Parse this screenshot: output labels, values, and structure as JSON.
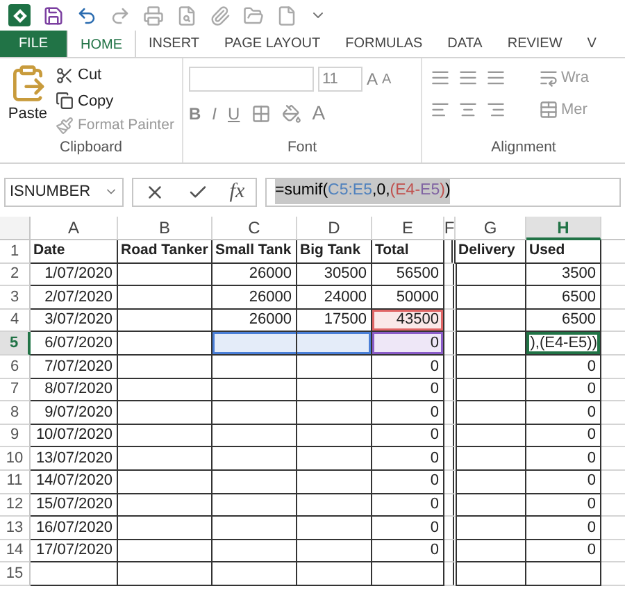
{
  "tabs": [
    {
      "label": "FILE",
      "kind": "file",
      "selected": false
    },
    {
      "label": "HOME",
      "kind": "tab",
      "selected": true
    },
    {
      "label": "INSERT",
      "kind": "tab",
      "selected": false
    },
    {
      "label": "PAGE LAYOUT",
      "kind": "tab",
      "selected": false
    },
    {
      "label": "FORMULAS",
      "kind": "tab",
      "selected": false
    },
    {
      "label": "DATA",
      "kind": "tab",
      "selected": false
    },
    {
      "label": "REVIEW",
      "kind": "tab",
      "selected": false
    },
    {
      "label": "V",
      "kind": "tab",
      "selected": false
    }
  ],
  "clipboard": {
    "paste": "Paste",
    "cut": "Cut",
    "copy": "Copy",
    "format_painter": "Format Painter",
    "label": "Clipboard"
  },
  "font": {
    "size": "11",
    "grow_font": "A",
    "shrink_font": "A",
    "label": "Font",
    "bold": "B",
    "italic": "I",
    "underline": "U",
    "font_color": "A"
  },
  "alignment": {
    "wrap": "Wra",
    "merge": "Mer",
    "label": "Alignment"
  },
  "name_box": "ISNUMBER",
  "insert_function": "fx",
  "formula": [
    {
      "text": "=sumif(",
      "color": "#000000"
    },
    {
      "text": "C5:E5",
      "color": "#4f81bd"
    },
    {
      "text": ",0,",
      "color": "#000000"
    },
    {
      "text": "(E4-",
      "color": "#c0504d"
    },
    {
      "text": "E5",
      "color": "#8064a2"
    },
    {
      "text": ")",
      "color": "#c0504d"
    },
    {
      "text": ")",
      "color": "#000000"
    }
  ],
  "columns": [
    {
      "label": "A",
      "selected": false
    },
    {
      "label": "B",
      "selected": false
    },
    {
      "label": "C",
      "selected": false
    },
    {
      "label": "D",
      "selected": false
    },
    {
      "label": "E",
      "selected": false
    },
    {
      "label": "F",
      "selected": false
    },
    {
      "label": "G",
      "selected": false
    },
    {
      "label": "H",
      "selected": true
    }
  ],
  "rows": [
    {
      "label": "1",
      "selected": false,
      "cells": [
        {
          "text": "Date"
        },
        {
          "text": "Road Tanker"
        },
        {
          "text": "Small Tank"
        },
        {
          "text": "Big Tank"
        },
        {
          "text": "Total"
        },
        {},
        {
          "text": "Delivery"
        },
        {
          "text": "Used"
        }
      ]
    },
    {
      "label": "2",
      "selected": false,
      "cells": [
        {
          "text": "1/07/2020"
        },
        {},
        {
          "text": "26000"
        },
        {
          "text": "30500"
        },
        {
          "text": "56500"
        },
        {},
        {},
        {
          "text": "3500"
        }
      ]
    },
    {
      "label": "3",
      "selected": false,
      "cells": [
        {
          "text": "2/07/2020"
        },
        {},
        {
          "text": "26000"
        },
        {
          "text": "24000"
        },
        {
          "text": "50000"
        },
        {},
        {},
        {
          "text": "6500"
        }
      ]
    },
    {
      "label": "4",
      "selected": false,
      "cells": [
        {
          "text": "3/07/2020"
        },
        {},
        {
          "text": "26000"
        },
        {
          "text": "17500"
        },
        {
          "text": "43500",
          "color": "#e06666"
        },
        {},
        {},
        {
          "text": "6500"
        }
      ]
    },
    {
      "label": "5",
      "selected": true,
      "cells": [
        {
          "text": "6/07/2020"
        },
        {},
        {
          "color": "#4a7fd8"
        },
        {
          "color": "#4a7fd8"
        },
        {
          "text": "0",
          "color": "#8a5cc8"
        },
        {},
        {},
        {
          "text": "),(E4-E5))",
          "active": true
        }
      ]
    },
    {
      "label": "6",
      "selected": false,
      "cells": [
        {
          "text": "7/07/2020"
        },
        {},
        {},
        {},
        {
          "text": "0"
        },
        {},
        {},
        {
          "text": "0"
        }
      ]
    },
    {
      "label": "7",
      "selected": false,
      "cells": [
        {
          "text": "8/07/2020"
        },
        {},
        {},
        {},
        {
          "text": "0"
        },
        {},
        {},
        {
          "text": "0"
        }
      ]
    },
    {
      "label": "8",
      "selected": false,
      "cells": [
        {
          "text": "9/07/2020"
        },
        {},
        {},
        {},
        {
          "text": "0"
        },
        {},
        {},
        {
          "text": "0"
        }
      ]
    },
    {
      "label": "9",
      "selected": false,
      "cells": [
        {
          "text": "10/07/2020"
        },
        {},
        {},
        {},
        {
          "text": "0"
        },
        {},
        {},
        {
          "text": "0"
        }
      ]
    },
    {
      "label": "10",
      "selected": false,
      "cells": [
        {
          "text": "13/07/2020"
        },
        {},
        {},
        {},
        {
          "text": "0"
        },
        {},
        {},
        {
          "text": "0"
        }
      ]
    },
    {
      "label": "11",
      "selected": false,
      "cells": [
        {
          "text": "14/07/2020"
        },
        {},
        {},
        {},
        {
          "text": "0"
        },
        {},
        {},
        {
          "text": "0"
        }
      ]
    },
    {
      "label": "12",
      "selected": false,
      "cells": [
        {
          "text": "15/07/2020"
        },
        {},
        {},
        {},
        {
          "text": "0"
        },
        {},
        {},
        {
          "text": "0"
        }
      ]
    },
    {
      "label": "13",
      "selected": false,
      "cells": [
        {
          "text": "16/07/2020"
        },
        {},
        {},
        {},
        {
          "text": "0"
        },
        {},
        {},
        {
          "text": "0"
        }
      ]
    },
    {
      "label": "14",
      "selected": false,
      "cells": [
        {
          "text": "17/07/2020"
        },
        {},
        {},
        {},
        {
          "text": "0"
        },
        {},
        {},
        {
          "text": "0"
        }
      ]
    },
    {
      "label": "15",
      "selected": false,
      "cells": [
        {},
        {},
        {},
        {},
        {},
        {},
        {},
        {}
      ]
    }
  ]
}
